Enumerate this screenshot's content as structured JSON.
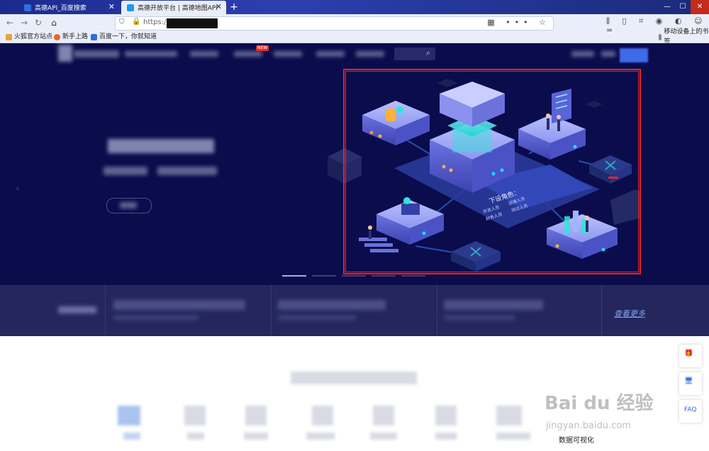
{
  "browser": {
    "tabs": [
      {
        "title": "高德API_百度搜索",
        "active": false
      },
      {
        "title": "高德开放平台 | 高德地图API",
        "active": true
      }
    ],
    "url_prefix": "https://",
    "bookmarks": [
      "火狐官方站点",
      "新手上路",
      "百度一下，你就知道"
    ],
    "mobile_bookmarks": "移动设备上的书签"
  },
  "site": {
    "new_badge": "NEW",
    "more_link": "查看更多",
    "caption": "数据可视化"
  },
  "illustration": {
    "panel_title": "下设角色：",
    "panel_roles": [
      "开发人员",
      "运维人员",
      "财务人员",
      "测试人员"
    ]
  },
  "sidebar": {
    "faq_label": "FAQ"
  },
  "watermark": {
    "logo": "Bai du 经验",
    "sub": "jingyan.baidu.com"
  },
  "colors": {
    "hero_bg": "#0a0c4b",
    "features_bg": "#24265c",
    "highlight_frame": "#e0242a",
    "accent": "#3f6ae8"
  }
}
